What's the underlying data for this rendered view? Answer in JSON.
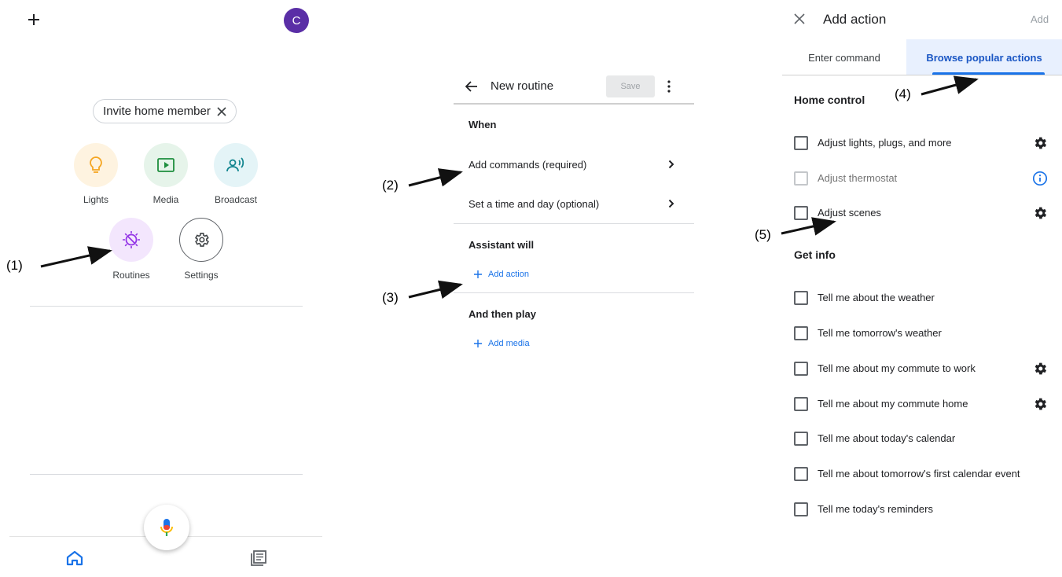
{
  "panel1": {
    "avatar_initial": "C",
    "invite_chip": "Invite home member",
    "tiles": [
      {
        "label": "Lights",
        "icon": "lightbulb-icon",
        "color": "#f5a623",
        "bg": "#fef3e0"
      },
      {
        "label": "Media",
        "icon": "media-icon",
        "color": "#1e8e3e",
        "bg": "#e6f4ea"
      },
      {
        "label": "Broadcast",
        "icon": "broadcast-icon",
        "color": "#12858f",
        "bg": "#e4f4f7"
      },
      {
        "label": "Routines",
        "icon": "routines-icon",
        "color": "#9334e6",
        "bg": "#f3e6fd"
      },
      {
        "label": "Settings",
        "icon": "gear-icon",
        "color": "#3c4043",
        "bg": "#ffffff"
      }
    ],
    "nav": {
      "home_icon": "home-icon",
      "feed_icon": "feed-icon"
    }
  },
  "panel2": {
    "title": "New routine",
    "save_label": "Save",
    "when_heading": "When",
    "when_items": [
      "Add commands (required)",
      "Set a time and day (optional)"
    ],
    "assistant_heading": "Assistant will",
    "add_action": "Add action",
    "then_heading": "And then play",
    "add_media": "Add media"
  },
  "panel3": {
    "title": "Add action",
    "add_label": "Add",
    "tabs": [
      "Enter command",
      "Browse popular actions"
    ],
    "active_tab": "Browse popular actions",
    "home_control_heading": "Home control",
    "home_control_items": [
      {
        "label": "Adjust lights, plugs, and more",
        "trailing": "gear-icon",
        "disabled": false
      },
      {
        "label": "Adjust thermostat",
        "trailing": "info-icon",
        "disabled": true
      },
      {
        "label": "Adjust scenes",
        "trailing": "gear-icon",
        "disabled": false
      }
    ],
    "get_info_heading": "Get info",
    "get_info_items": [
      {
        "label": "Tell me about the weather",
        "trailing": ""
      },
      {
        "label": "Tell me tomorrow's weather",
        "trailing": ""
      },
      {
        "label": "Tell me about my commute to work",
        "trailing": "gear-icon"
      },
      {
        "label": "Tell me about my commute home",
        "trailing": "gear-icon"
      },
      {
        "label": "Tell me about today's calendar",
        "trailing": ""
      },
      {
        "label": "Tell me about tomorrow's first calendar event",
        "trailing": ""
      },
      {
        "label": "Tell me today's reminders",
        "trailing": ""
      }
    ]
  },
  "annotations": [
    "(1)",
    "(2)",
    "(3)",
    "(4)",
    "(5)"
  ],
  "colors": {
    "accent": "#1a73e8",
    "avatar": "#5a2ea6"
  }
}
